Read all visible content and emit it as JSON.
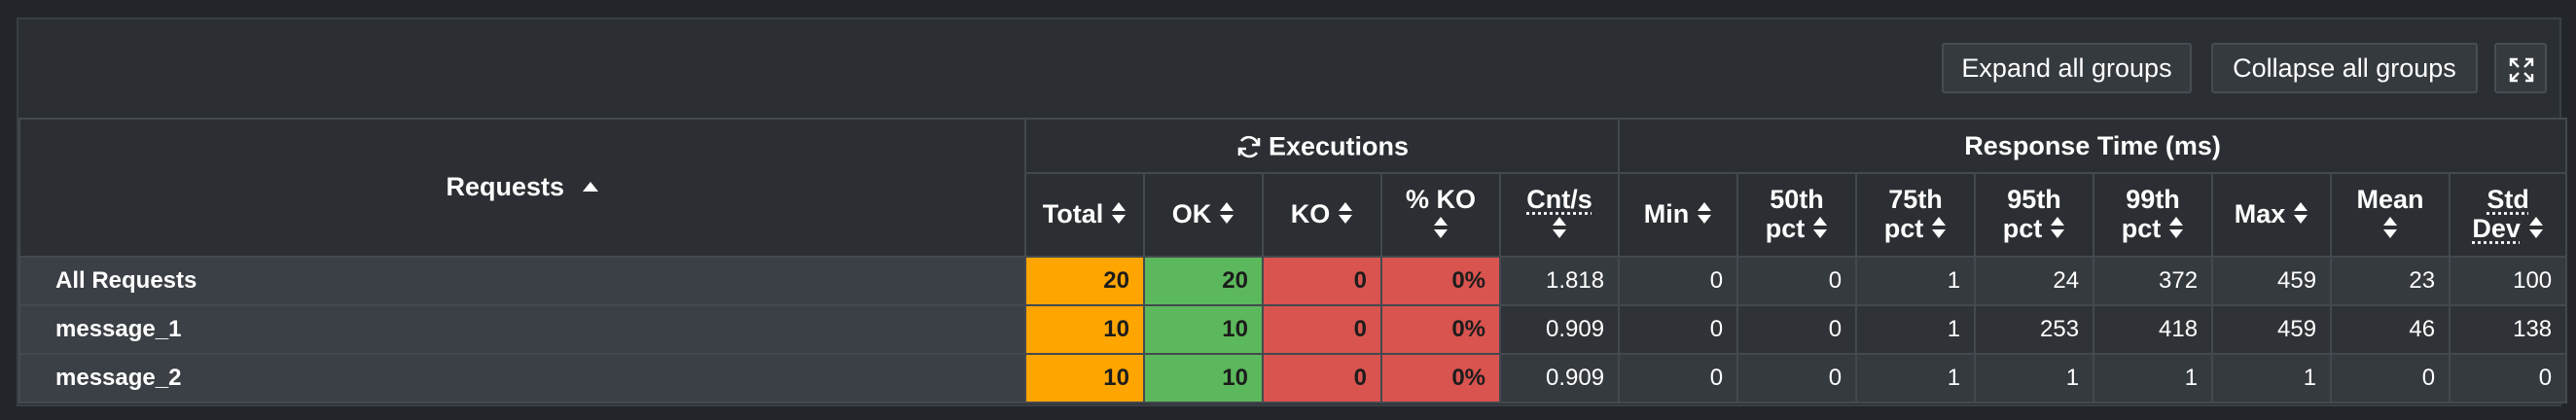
{
  "toolbar": {
    "expand_label": "Expand all groups",
    "collapse_label": "Collapse all groups",
    "fullscreen_icon": "fullscreen-icon"
  },
  "header": {
    "requests": "Requests",
    "executions": "Executions",
    "response_time": "Response Time (ms)",
    "columns": {
      "total": "Total",
      "ok": "OK",
      "ko": "KO",
      "pct_ko": "% KO",
      "cnt_s": "Cnt/s",
      "min": "Min",
      "p50_a": "50th",
      "p50_b": "pct",
      "p75_a": "75th",
      "p75_b": "pct",
      "p95_a": "95th",
      "p95_b": "pct",
      "p99_a": "99th",
      "p99_b": "pct",
      "max": "Max",
      "mean": "Mean",
      "std_a": "Std",
      "std_b": "Dev"
    }
  },
  "rows": [
    {
      "name": "All Requests",
      "total": "20",
      "ok": "20",
      "ko": "0",
      "pct_ko": "0%",
      "cnt_s": "1.818",
      "min": "0",
      "p50": "0",
      "p75": "1",
      "p95": "24",
      "p99": "372",
      "max": "459",
      "mean": "23",
      "std": "100"
    },
    {
      "name": "message_1",
      "total": "10",
      "ok": "10",
      "ko": "0",
      "pct_ko": "0%",
      "cnt_s": "0.909",
      "min": "0",
      "p50": "0",
      "p75": "1",
      "p95": "253",
      "p99": "418",
      "max": "459",
      "mean": "46",
      "std": "138"
    },
    {
      "name": "message_2",
      "total": "10",
      "ok": "10",
      "ko": "0",
      "pct_ko": "0%",
      "cnt_s": "0.909",
      "min": "0",
      "p50": "0",
      "p75": "1",
      "p95": "1",
      "p99": "1",
      "max": "1",
      "mean": "0",
      "std": "0"
    }
  ],
  "colors": {
    "total": "#ffa500",
    "ok": "#5cb85c",
    "ko": "#d9534f"
  }
}
